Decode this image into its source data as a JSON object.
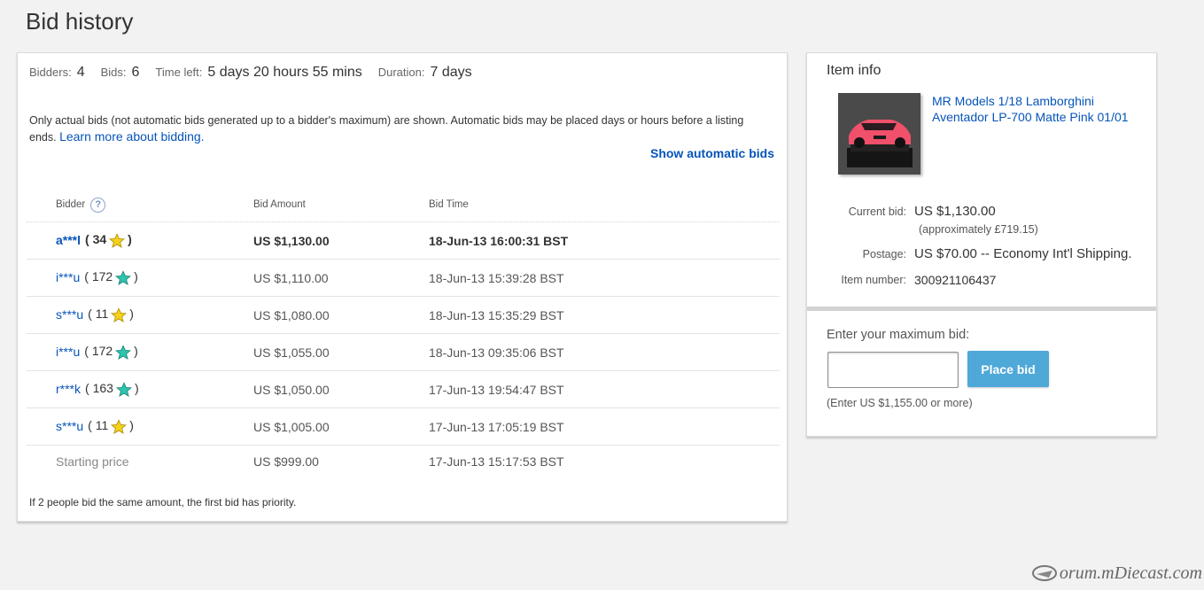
{
  "page": {
    "title": "Bid history"
  },
  "summary": {
    "bidders_label": "Bidders:",
    "bidders_value": "4",
    "bids_label": "Bids:",
    "bids_value": "6",
    "time_left_label": "Time left:",
    "time_left_value": "5 days 20 hours 55 mins",
    "duration_label": "Duration:",
    "duration_value": "7 days"
  },
  "notice": {
    "text": "Only actual bids (not automatic bids generated up to a bidder's maximum) are shown. Automatic bids may be placed days or hours before a listing ends.",
    "link": "Learn more about bidding."
  },
  "show_auto_label": "Show automatic bids",
  "table": {
    "headers": {
      "bidder": "Bidder",
      "amount": "Bid Amount",
      "time": "Bid Time"
    },
    "rows": [
      {
        "bidder": "a***l",
        "score": "34",
        "star": "yellow",
        "amount": "US $1,130.00",
        "time": "18-Jun-13 16:00:31 BST"
      },
      {
        "bidder": "i***u",
        "score": "172",
        "star": "teal",
        "amount": "US $1,110.00",
        "time": "18-Jun-13 15:39:28 BST"
      },
      {
        "bidder": "s***u",
        "score": "11",
        "star": "yellow",
        "amount": "US $1,080.00",
        "time": "18-Jun-13 15:35:29 BST"
      },
      {
        "bidder": "i***u",
        "score": "172",
        "star": "teal",
        "amount": "US $1,055.00",
        "time": "18-Jun-13 09:35:06 BST"
      },
      {
        "bidder": "r***k",
        "score": "163",
        "star": "teal",
        "amount": "US $1,050.00",
        "time": "17-Jun-13 19:54:47 BST"
      },
      {
        "bidder": "s***u",
        "score": "11",
        "star": "yellow",
        "amount": "US $1,005.00",
        "time": "17-Jun-13 17:05:19 BST"
      }
    ],
    "starting": {
      "label": "Starting price",
      "amount": "US $999.00",
      "time": "17-Jun-13 15:17:53 BST"
    }
  },
  "footnote": "If 2 people bid the same amount, the first bid has priority.",
  "item": {
    "section_title": "Item info",
    "title": "MR Models 1/18 Lamborghini Aventador LP-700 Matte Pink 01/01",
    "current_bid_label": "Current bid:",
    "current_bid_value": "US $1,130.00",
    "approx": "(approximately £719.15)",
    "postage_label": "Postage:",
    "postage_value": "US $70.00 -- Economy Int'l Shipping.",
    "item_number_label": "Item number:",
    "item_number_value": "300921106437"
  },
  "bid_form": {
    "label": "Enter your maximum bid:",
    "input_value": "",
    "button": "Place bid",
    "hint": "(Enter US $1,155.00 or more)"
  },
  "watermark": "orum.mDiecast.com",
  "colors": {
    "link": "#0654ba",
    "button": "#4ea8d8",
    "star_yellow": "#f5d21b",
    "star_teal": "#2ec4b0"
  }
}
